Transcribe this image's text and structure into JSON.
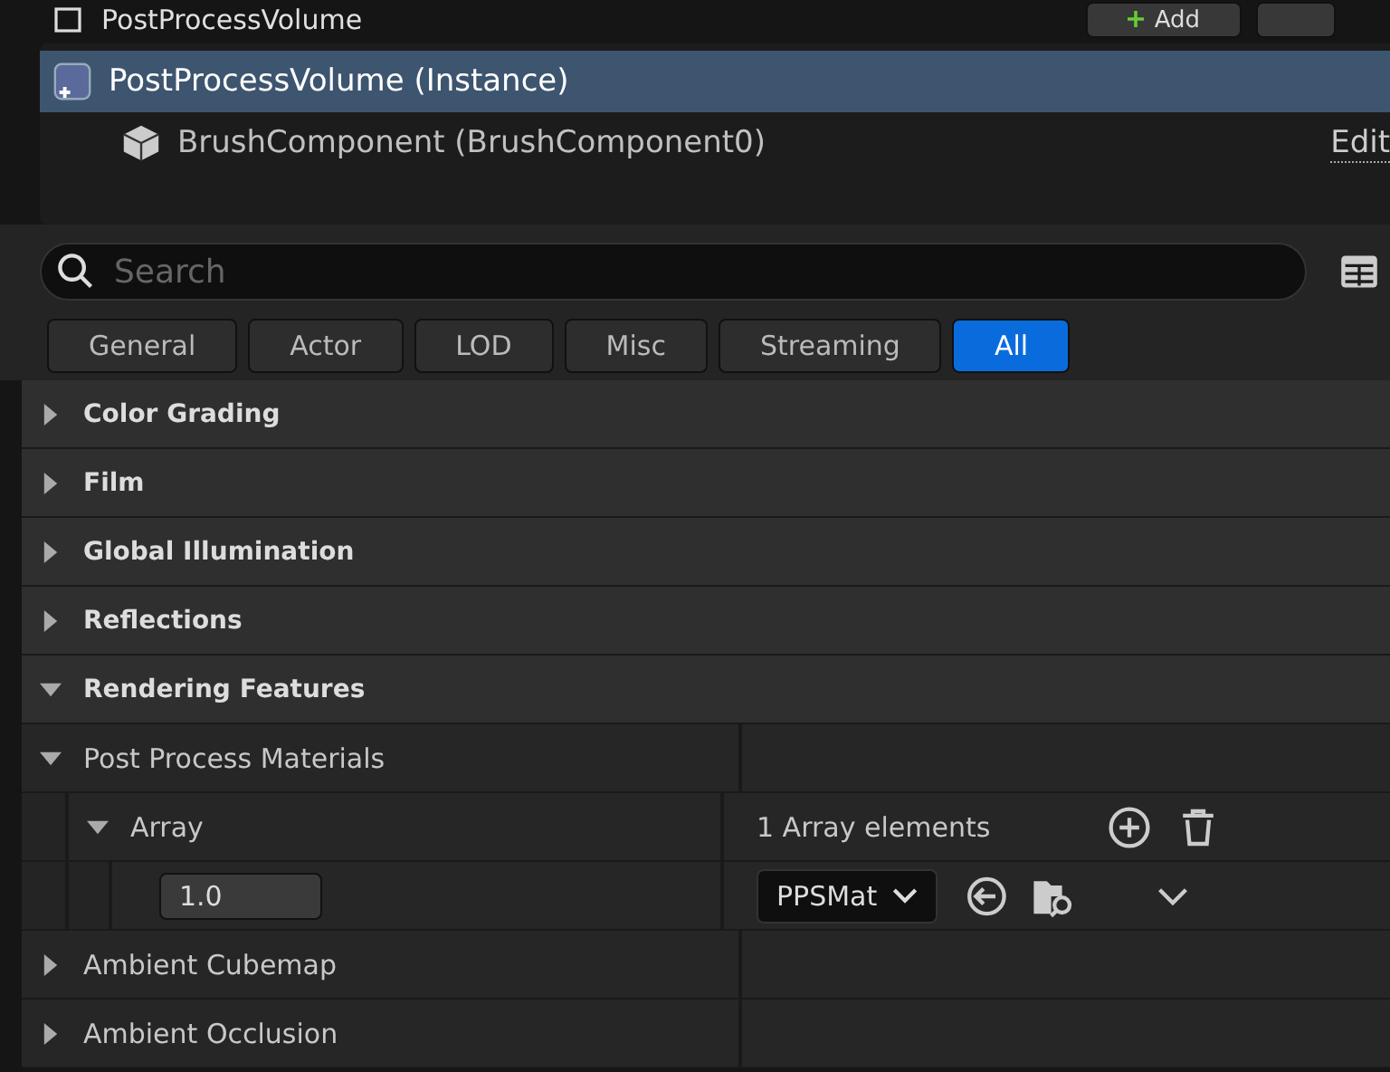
{
  "header": {
    "title": "PostProcessVolume",
    "add_button": "Add"
  },
  "components": [
    {
      "kind": "actor",
      "label": "PostProcessVolume (Instance)",
      "selected": true
    },
    {
      "kind": "component",
      "label": "BrushComponent (BrushComponent0)",
      "selected": false,
      "link": "Edit"
    }
  ],
  "search": {
    "placeholder": "Search"
  },
  "filters": [
    {
      "label": "General",
      "selected": false
    },
    {
      "label": "Actor",
      "selected": false
    },
    {
      "label": "LOD",
      "selected": false
    },
    {
      "label": "Misc",
      "selected": false
    },
    {
      "label": "Streaming",
      "selected": false
    },
    {
      "label": "All",
      "selected": true
    }
  ],
  "categories": [
    {
      "label": "Color Grading",
      "expanded": false
    },
    {
      "label": "Film",
      "expanded": false
    },
    {
      "label": "Global Illumination",
      "expanded": false
    },
    {
      "label": "Reflections",
      "expanded": false
    },
    {
      "label": "Rendering Features",
      "expanded": true
    }
  ],
  "properties": [
    {
      "label": "Post Process Materials",
      "expanded": true,
      "children": [
        {
          "label": "Array",
          "expanded": true,
          "value": "1 Array elements",
          "children": [
            {
              "weight": "1.0",
              "asset": "PPSMat"
            }
          ]
        }
      ]
    },
    {
      "label": "Ambient Cubemap",
      "expanded": false
    },
    {
      "label": "Ambient Occlusion",
      "expanded": false
    }
  ]
}
